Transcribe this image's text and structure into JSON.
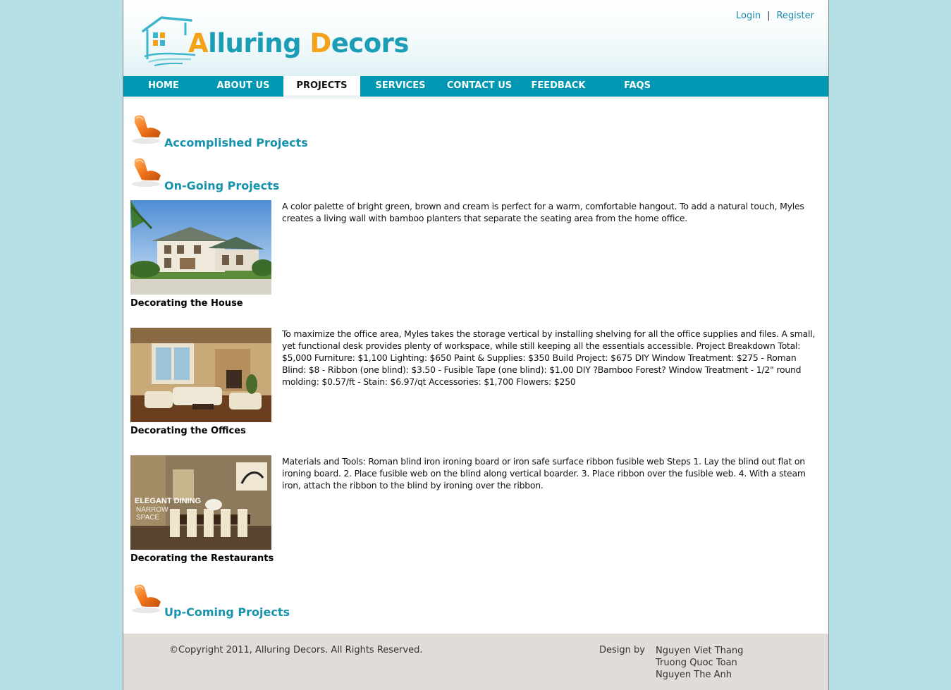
{
  "header": {
    "logo_text_first_cap": "A",
    "logo_text_first_rest": "lluring ",
    "logo_text_second_cap": "D",
    "logo_text_second_rest": "ecors",
    "login_label": "Login",
    "separator": "|",
    "register_label": "Register"
  },
  "nav": {
    "items": [
      {
        "label": "HOME"
      },
      {
        "label": "ABOUT US"
      },
      {
        "label": "PROJECTS",
        "active": true
      },
      {
        "label": "SERVICES"
      },
      {
        "label": "CONTACT US"
      },
      {
        "label": "FEEDBACK"
      },
      {
        "label": "FAQS"
      }
    ]
  },
  "sections": {
    "accomplished": "Accomplished Projects",
    "ongoing": "On-Going Projects",
    "upcoming": "Up-Coming Projects"
  },
  "projects": [
    {
      "caption": "Decorating the House",
      "description": "A color palette of bright green, brown and cream is perfect for a warm, comfortable hangout. To add a natural touch, Myles creates a living wall with bamboo planters that separate the seating area from the home office."
    },
    {
      "caption": "Decorating the Offices",
      "description": "To maximize the office area, Myles takes the storage vertical by installing shelving for all the office supplies and files. A small, yet functional desk provides plenty of workspace, while still keeping all the essentials accessible. Project Breakdown Total: $5,000 Furniture: $1,100 Lighting: $650 Paint & Supplies: $350 Build Project: $675 DIY Window Treatment: $275 - Roman Blind: $8 - Ribbon (one blind): $3.50 - Fusible Tape (one blind): $1.00 DIY ?Bamboo Forest? Window Treatment - 1/2\" round molding: $0.57/ft - Stain: $6.97/qt Accessories: $1,700 Flowers: $250"
    },
    {
      "caption": "Decorating the Restaurants",
      "description": "Materials and Tools: Roman blind iron ironing board or iron safe surface ribbon fusible web Steps 1. Lay the blind out flat on ironing board. 2. Place fusible web on the blind along vertical boarder. 3. Place ribbon over the fusible web. 4. With a steam iron, attach the ribbon to the blind by ironing over the ribbon.",
      "photo_overlay": [
        "ELEGANT DINING",
        "NARROW",
        "SPACE"
      ]
    }
  ],
  "footer": {
    "copyright": "©Copyright 2011, Alluring Decors. All Rights Reserved.",
    "design_label": "Design by",
    "designers": [
      "Nguyen Viet Thang",
      "Truong Quoc Toan",
      "Nguyen The Anh"
    ]
  },
  "colors": {
    "background": "#b4e0e6",
    "nav": "#0097b4",
    "heading": "#1593ad",
    "logo_blue": "#1a9db5",
    "logo_orange": "#f5a21b",
    "footer": "#e0dcd8"
  }
}
